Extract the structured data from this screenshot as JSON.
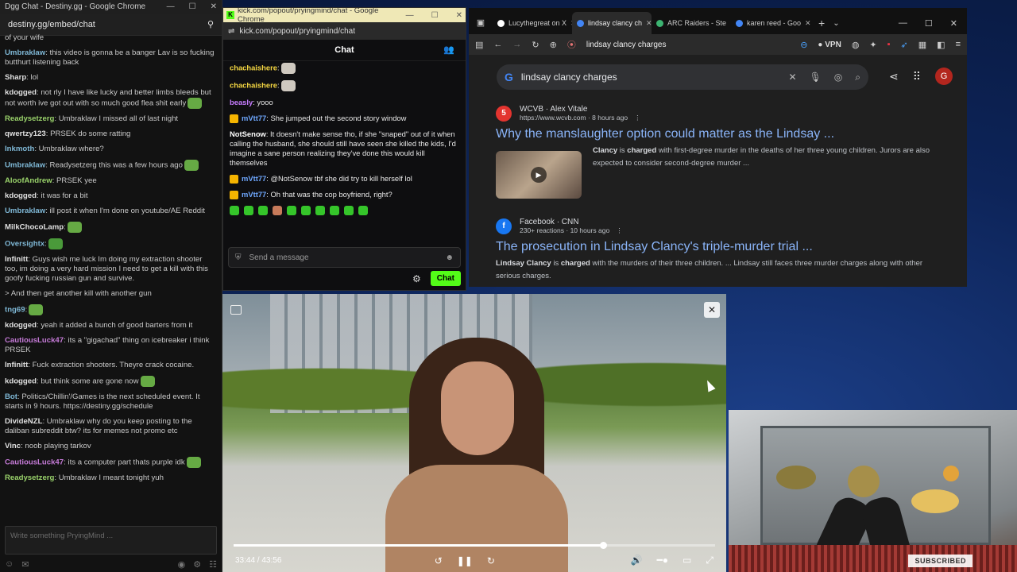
{
  "dgg": {
    "title": "Dgg Chat - Destiny.gg - Google Chrome",
    "url": "destiny.gg/embed/chat",
    "input_placeholder": "Write something PryingMind ...",
    "messages": [
      {
        "user": "",
        "text": "of your wife",
        "color": "#c9c9c9"
      },
      {
        "user": "Umbraklaw",
        "text": ": this video is gonna be a banger Lav is so fucking butthurt listening back",
        "color": "#7fb8d6"
      },
      {
        "user": "Sharp",
        "text": ": lol",
        "color": "#e0e0e0"
      },
      {
        "user": "kdogged",
        "text": ": not rly  I have like lucky and better limbs bleeds but not worth ive got out with so much good flea shit early",
        "color": "#e0e0e0"
      },
      {
        "user": "Readysetzerg",
        "text": ": Umbraklaw I missed all of last night",
        "color": "#9ad36b"
      },
      {
        "user": "qwertzy123",
        "text": ": PRSEK do some ratting",
        "color": "#e0e0e0"
      },
      {
        "user": "Inkmoth",
        "text": ": Umbraklaw where?",
        "color": "#7fb8d6"
      },
      {
        "user": "Umbraklaw",
        "text": ": Readysetzerg this was a few hours ago",
        "color": "#7fb8d6"
      },
      {
        "user": "AloofAndrew",
        "text": ": PRSEK yee",
        "color": "#9ad36b"
      },
      {
        "user": "kdogged",
        "text": ": it was for a bit",
        "color": "#e0e0e0"
      },
      {
        "user": "Umbraklaw",
        "text": ": ill post it when I'm done on youtube/AE Reddit",
        "color": "#7fb8d6"
      },
      {
        "user": "MilkChocoLamp",
        "text": ":",
        "color": "#e0e0e0"
      },
      {
        "user": "Oversightx",
        "text": ":",
        "color": "#7fb8d6"
      },
      {
        "user": "Infinitt",
        "text": ": Guys wish me luck Im doing my extraction shooter too, im doing a very hard mission  I need to get a kill with this goofy fucking russian gun and survive.",
        "color": "#e0e0e0"
      },
      {
        "user": "",
        "text": "> And then get another kill with another gun",
        "color": "#c9c9c9"
      },
      {
        "user": "tng69",
        "text": ":",
        "color": "#7fb8d6"
      },
      {
        "user": "kdogged",
        "text": ": yeah it added a bunch of good barters from it",
        "color": "#e0e0e0"
      },
      {
        "user": "CautiousLuck47",
        "text": ": its a \"gigachad\" thing on icebreaker i think PRSEK",
        "color": "#c67bd8"
      },
      {
        "user": "Infinitt",
        "text": ": Fuck extraction shooters. Theyre crack cocaine.",
        "color": "#e0e0e0"
      },
      {
        "user": "kdogged",
        "text": ": but think some are gone now",
        "color": "#e0e0e0"
      },
      {
        "user": "Bot",
        "text": ": Politics/Chillin'/Games is the next scheduled event. It starts in 9 hours. https://destiny.gg/schedule",
        "color": "#7fb8d6"
      },
      {
        "user": "DivideNZL",
        "text": ": Umbraklaw why do you keep posting to the daliban subreddit btw? its for memes not promo etc",
        "color": "#e0e0e0"
      },
      {
        "user": "Vinc",
        "text": ":  noob playing tarkov",
        "color": "#e0e0e0"
      },
      {
        "user": "CautiousLuck47",
        "text": ": its a computer part thats purple idk",
        "color": "#c67bd8"
      },
      {
        "user": "Readysetzerg",
        "text": ": Umbraklaw I meant tonight yuh",
        "color": "#9ad36b"
      }
    ]
  },
  "kick": {
    "title": "kick.com/popout/pryingmind/chat - Google Chrome",
    "url": "kick.com/popout/pryingmind/chat",
    "header": "Chat",
    "send_placeholder": "Send a message",
    "chat_button": "Chat",
    "messages": [
      {
        "user": "chachaishere",
        "text": ":",
        "color": "#f5d742",
        "badge": false
      },
      {
        "user": "chachaishere",
        "text": ":",
        "color": "#f5d742",
        "badge": false
      },
      {
        "user": "beasly",
        "text": ": yooo",
        "color": "#c77dff",
        "badge": false
      },
      {
        "user": "mVtt77",
        "text": ": She jumped out the second story window",
        "color": "#6fa8ff",
        "badge": true
      },
      {
        "user": "NotSenow",
        "text": ": It doesn't make sense tho, if she \"snaped\" out of it when calling the husband, she should still have seen she killed the kids, I'd imagine a sane person realizing they've done this would kill themselves",
        "color": "#ffffff",
        "badge": false
      },
      {
        "user": "mVtt77",
        "text": ": @NotSenow tbf she did try to kill herself lol",
        "color": "#6fa8ff",
        "badge": true
      },
      {
        "user": "mVtt77",
        "text": ": Oh that was the cop boyfriend, right?",
        "color": "#6fa8ff",
        "badge": true
      }
    ]
  },
  "browser": {
    "tabs": [
      {
        "label": "Lucythegreat on X",
        "fav": "#ffffff",
        "active": false
      },
      {
        "label": "lindsay clancy ch",
        "fav": "#4285f4",
        "active": true
      },
      {
        "label": "ARC Raiders - Ste",
        "fav": "#3cb371",
        "active": false
      },
      {
        "label": "karen reed - Goo",
        "fav": "#4285f4",
        "active": false
      }
    ],
    "omnibox": "lindsay clancy charges",
    "vpn": "VPN",
    "avatar": "G",
    "search_query": "lindsay clancy charges",
    "results": [
      {
        "logo": "5",
        "logo_color": "#e3342f",
        "source": "WCVB · Alex Vitale",
        "url": "https://www.wcvb.com",
        "age": "8 hours ago",
        "title": "Why the manslaughter option could matter as the Lindsay ...",
        "snippet_b1": "Clancy",
        "snippet_1": " is ",
        "snippet_b2": "charged",
        "snippet_2": " with first-degree murder in the deaths of her three young children. Jurors are also expected to consider second-degree murder ..."
      },
      {
        "logo": "f",
        "logo_color": "#1877f2",
        "source": "Facebook · CNN",
        "url": "230+ reactions",
        "age": "10 hours ago",
        "title": "The prosecution in Lindsay Clancy's triple-murder trial ...",
        "snippet_b1": "Lindsay Clancy",
        "snippet_1": " is ",
        "snippet_b2": "charged",
        "snippet_2": " with the murders of their three children. ... Lindsay still faces three murder charges along with other serious charges."
      }
    ]
  },
  "video": {
    "current": "33:44",
    "duration": "43:56",
    "progress": 0.768
  },
  "cam": {
    "badge": "SUBSCRIBED"
  }
}
